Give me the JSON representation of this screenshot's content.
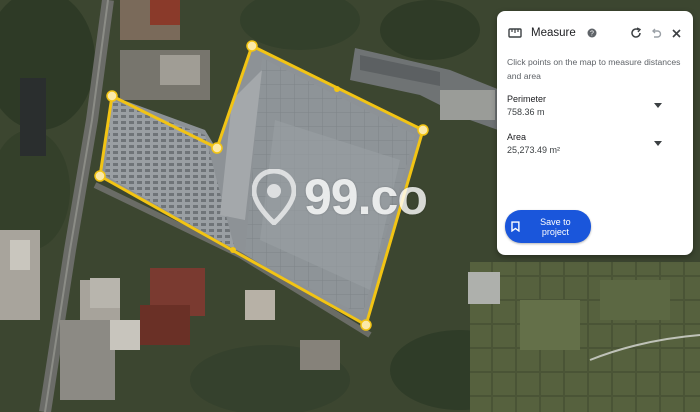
{
  "map": {
    "type": "satellite",
    "watermark": "99.co",
    "polygon_color": "#f2c414"
  },
  "measure": {
    "title": "Measure",
    "instructions": "Click points on the map to measure distances and area",
    "perimeter_label": "Perimeter",
    "perimeter_value": "758.36 m",
    "area_label": "Area",
    "area_value": "25,273.49 m²",
    "save_label": "Save to project",
    "accent_color": "#1a56db"
  }
}
